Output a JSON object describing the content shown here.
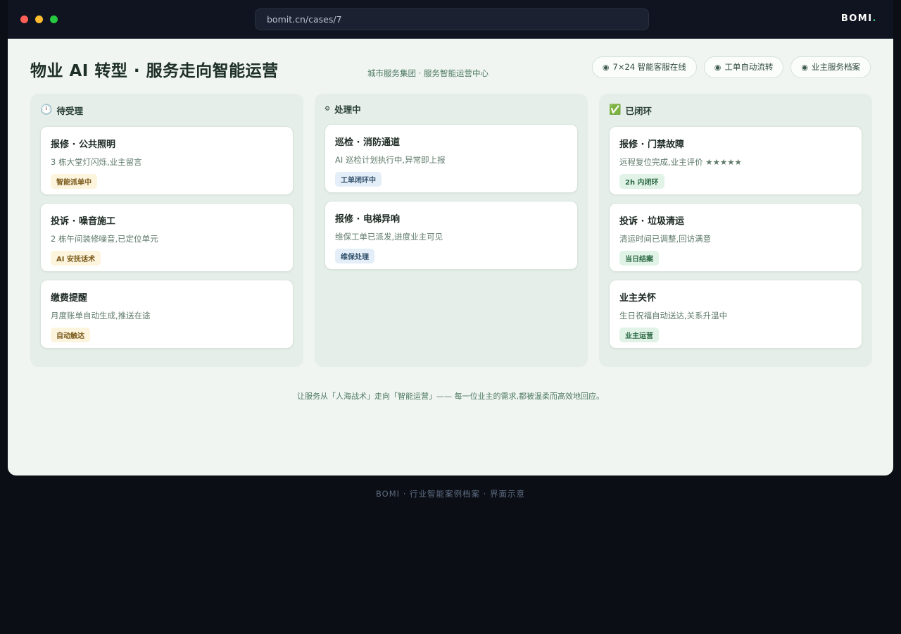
{
  "browser": {
    "url": "bomit.cn/cases/7",
    "brand": "BOMI",
    "brand_dot": "."
  },
  "header": {
    "title": "物业 AI 转型 · 服务走向智能运营",
    "subtitle": "城市服务集团 · 服务智能运营中心",
    "chips": [
      {
        "icon": "◉",
        "label": "7×24 智能客服在线"
      },
      {
        "icon": "◉",
        "label": "工单自动流转"
      },
      {
        "icon": "◉",
        "label": "业主服务档案"
      }
    ]
  },
  "columns": [
    {
      "icon": "🕛",
      "title": "待受理",
      "cards": [
        {
          "title": "报修 · 公共照明",
          "desc": "3 栋大堂灯闪烁,业主留言",
          "tag": "智能派单中",
          "tag_color": "yellow"
        },
        {
          "title": "投诉 · 噪音施工",
          "desc": "2 栋午间装修噪音,已定位单元",
          "tag": "AI 安抚话术",
          "tag_color": "yellow"
        },
        {
          "title": "缴费提醒",
          "desc": "月度账单自动生成,推送在途",
          "tag": "自动触达",
          "tag_color": "yellow"
        }
      ]
    },
    {
      "icon": "⚙",
      "title": "处理中",
      "cards": [
        {
          "title": "巡检 · 消防通道",
          "desc": "AI 巡检计划执行中,异常即上报",
          "tag": "工单闭环中",
          "tag_color": "blue"
        },
        {
          "title": "报修 · 电梯异响",
          "desc": "维保工单已派发,进度业主可见",
          "tag": "维保处理",
          "tag_color": "blue"
        }
      ]
    },
    {
      "icon": "✅",
      "title": "已闭环",
      "cards": [
        {
          "title": "报修 · 门禁故障",
          "desc": "远程复位完成,业主评价 ★★★★★",
          "tag": "2h 内闭环",
          "tag_color": "green"
        },
        {
          "title": "投诉 · 垃圾清运",
          "desc": "清运时间已调整,回访满意",
          "tag": "当日结案",
          "tag_color": "green"
        },
        {
          "title": "业主关怀",
          "desc": "生日祝福自动送达,关系升温中",
          "tag": "业主运营",
          "tag_color": "green"
        }
      ]
    }
  ],
  "tagline": "让服务从「人海战术」走向「智能运营」—— 每一位业主的需求,都被温柔而高效地回应。",
  "footer": "BOMI · 行业智能案例档案 · 界面示意"
}
